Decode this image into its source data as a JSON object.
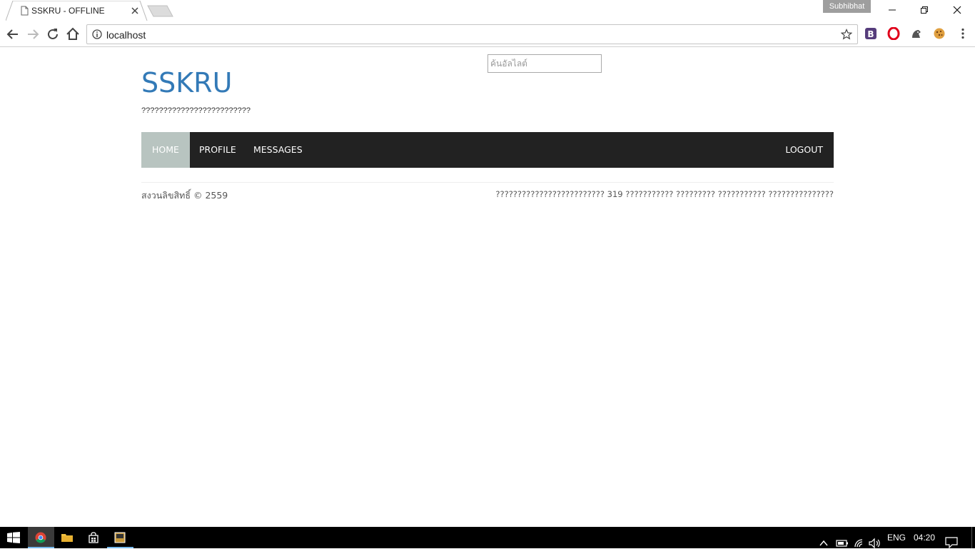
{
  "browser": {
    "tab_title": "SSKRU - OFFLINE",
    "profile_name": "Subhibhat",
    "url": "localhost"
  },
  "page": {
    "search_placeholder": "ค้นอัลไลต์",
    "site_title": "SSKRU",
    "site_subtitle": "?????????????????????????",
    "nav": {
      "home": "HOME",
      "profile": "PROFILE",
      "messages": "MESSAGES",
      "logout": "LOGOUT"
    },
    "footer_left": "สงวนลิขสิทธิ์ © 2559",
    "footer_right": "????????????????????????? 319 ??????????? ????????? ??????????? ???????????????"
  },
  "taskbar": {
    "language": "ENG",
    "time": "04:20"
  },
  "colors": {
    "link_blue": "#337ab7",
    "navbar_bg": "#222222",
    "nav_active_bg": "#b8c4c0"
  }
}
